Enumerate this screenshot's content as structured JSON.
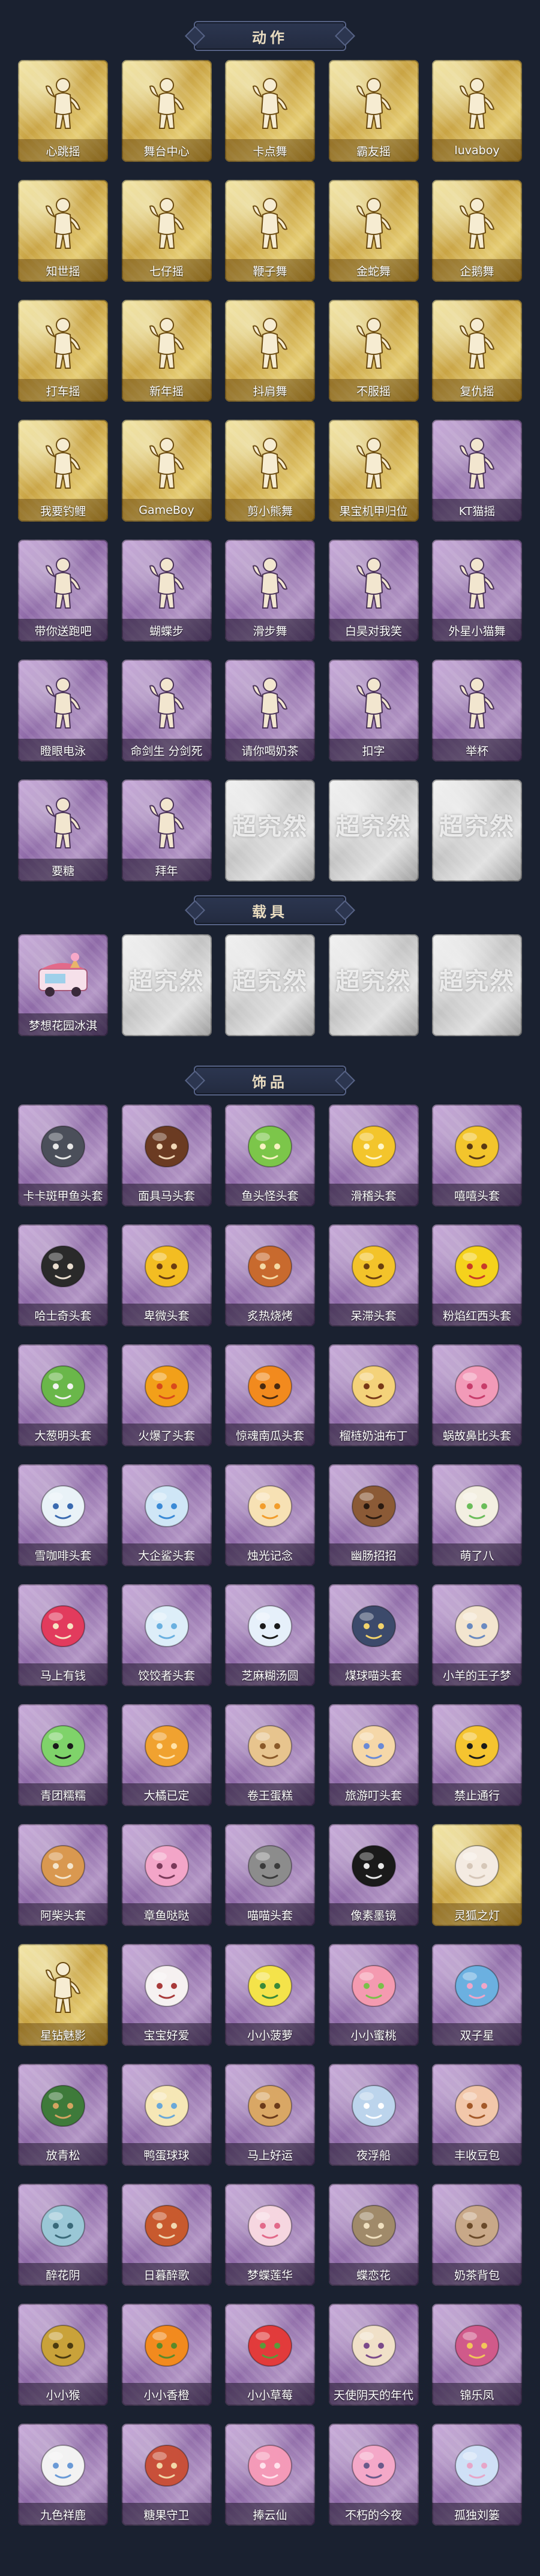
{
  "sections": [
    {
      "title": "动作",
      "items": [
        {
          "label": "心跳摇",
          "style": "gold",
          "icon": "pose-figure-icon"
        },
        {
          "label": "舞台中心",
          "style": "gold",
          "icon": "pose-figure-icon"
        },
        {
          "label": "卡点舞",
          "style": "gold",
          "icon": "pose-figure-icon"
        },
        {
          "label": "霸友摇",
          "style": "gold",
          "icon": "pose-figure-icon"
        },
        {
          "label": "luvaboy",
          "style": "gold",
          "icon": "pose-figure-icon"
        },
        {
          "label": "知世摇",
          "style": "gold",
          "icon": "pose-figure-icon"
        },
        {
          "label": "七仔摇",
          "style": "gold",
          "icon": "pose-figure-icon"
        },
        {
          "label": "鞭子舞",
          "style": "gold",
          "icon": "pose-figure-icon"
        },
        {
          "label": "金蛇舞",
          "style": "gold",
          "icon": "pose-figure-icon"
        },
        {
          "label": "企鹅舞",
          "style": "gold",
          "icon": "pose-figure-icon"
        },
        {
          "label": "打车摇",
          "style": "gold",
          "icon": "pose-figure-icon"
        },
        {
          "label": "新年摇",
          "style": "gold",
          "icon": "pose-figure-icon"
        },
        {
          "label": "抖肩舞",
          "style": "gold",
          "icon": "pose-figure-icon"
        },
        {
          "label": "不服摇",
          "style": "gold",
          "icon": "pose-figure-icon"
        },
        {
          "label": "复仇摇",
          "style": "gold",
          "icon": "pose-figure-icon"
        },
        {
          "label": "我要钓鲤",
          "style": "gold",
          "icon": "pose-figure-icon"
        },
        {
          "label": "GameBoy",
          "style": "gold",
          "icon": "pose-figure-icon"
        },
        {
          "label": "剪小熊舞",
          "style": "gold",
          "icon": "pose-figure-icon"
        },
        {
          "label": "果宝机甲归位",
          "style": "gold",
          "icon": "pose-figure-icon"
        },
        {
          "label": "KT猫摇",
          "style": "purple",
          "icon": "pose-figure-icon"
        },
        {
          "label": "带你送跑吧",
          "style": "purple",
          "icon": "pose-figure-icon"
        },
        {
          "label": "蝴蝶步",
          "style": "purple",
          "icon": "pose-figure-icon"
        },
        {
          "label": "滑步舞",
          "style": "purple",
          "icon": "pose-figure-icon"
        },
        {
          "label": "白昊对我笑",
          "style": "purple",
          "icon": "pose-figure-icon"
        },
        {
          "label": "外星小猫舞",
          "style": "purple",
          "icon": "pose-figure-icon"
        },
        {
          "label": "瞪眼电泳",
          "style": "purple",
          "icon": "pose-figure-icon"
        },
        {
          "label": "命剑生 分剑死",
          "style": "purple",
          "icon": "pose-figure-icon"
        },
        {
          "label": "请你喝奶茶",
          "style": "purple",
          "icon": "pose-figure-icon"
        },
        {
          "label": "扣字",
          "style": "purple",
          "icon": "pose-figure-icon"
        },
        {
          "label": "举杯",
          "style": "purple",
          "icon": "pose-figure-icon"
        },
        {
          "label": "要糖",
          "style": "purple",
          "icon": "pose-figure-icon"
        },
        {
          "label": "拜年",
          "style": "purple",
          "icon": "pose-figure-icon"
        },
        {
          "label": "超究然",
          "style": "silver",
          "icon": "locked"
        },
        {
          "label": "超究然",
          "style": "silver",
          "icon": "locked"
        },
        {
          "label": "超究然",
          "style": "silver",
          "icon": "locked"
        }
      ]
    },
    {
      "title": "载具",
      "items": [
        {
          "label": "梦想花园冰淇",
          "style": "purple",
          "icon": "ice-cream-truck-icon"
        },
        {
          "label": "超究然",
          "style": "silver",
          "icon": "locked"
        },
        {
          "label": "超究然",
          "style": "silver",
          "icon": "locked"
        },
        {
          "label": "超究然",
          "style": "silver",
          "icon": "locked"
        },
        {
          "label": "超究然",
          "style": "silver",
          "icon": "locked"
        }
      ]
    },
    {
      "title": "饰品",
      "items": [
        {
          "label": "卡卡斑甲鱼头套",
          "style": "purple",
          "icon": "mask-icon"
        },
        {
          "label": "面具马头套",
          "style": "purple",
          "icon": "mask-icon"
        },
        {
          "label": "鱼头怪头套",
          "style": "purple",
          "icon": "mask-icon"
        },
        {
          "label": "滑稽头套",
          "style": "purple",
          "icon": "mask-icon"
        },
        {
          "label": "嘻嘻头套",
          "style": "purple",
          "icon": "mask-icon"
        },
        {
          "label": "哈士奇头套",
          "style": "purple",
          "icon": "mask-icon"
        },
        {
          "label": "卑微头套",
          "style": "purple",
          "icon": "mask-icon"
        },
        {
          "label": "炙热烧烤",
          "style": "purple",
          "icon": "mask-icon"
        },
        {
          "label": "呆滞头套",
          "style": "purple",
          "icon": "mask-icon"
        },
        {
          "label": "粉焰红西头套",
          "style": "purple",
          "icon": "mask-icon"
        },
        {
          "label": "大葱明头套",
          "style": "purple",
          "icon": "mask-icon"
        },
        {
          "label": "火爆了头套",
          "style": "purple",
          "icon": "mask-icon"
        },
        {
          "label": "惊魂南瓜头套",
          "style": "purple",
          "icon": "mask-icon"
        },
        {
          "label": "榴梿奶油布丁",
          "style": "purple",
          "icon": "mask-icon"
        },
        {
          "label": "蜗故鼻比头套",
          "style": "purple",
          "icon": "mask-icon"
        },
        {
          "label": "雪咖啡头套",
          "style": "purple",
          "icon": "mask-icon"
        },
        {
          "label": "大企鲨头套",
          "style": "purple",
          "icon": "mask-icon"
        },
        {
          "label": "烛光记念",
          "style": "purple",
          "icon": "mask-icon"
        },
        {
          "label": "幽肠招招",
          "style": "purple",
          "icon": "mask-icon"
        },
        {
          "label": "萌了八",
          "style": "purple",
          "icon": "mask-icon"
        },
        {
          "label": "马上有钱",
          "style": "purple",
          "icon": "mask-icon"
        },
        {
          "label": "饺饺者头套",
          "style": "purple",
          "icon": "mask-icon"
        },
        {
          "label": "芝麻糊汤圆",
          "style": "purple",
          "icon": "mask-icon"
        },
        {
          "label": "煤球喵头套",
          "style": "purple",
          "icon": "mask-icon"
        },
        {
          "label": "小羊的王子梦",
          "style": "purple",
          "icon": "mask-icon"
        },
        {
          "label": "青团糯糯",
          "style": "purple",
          "icon": "mask-icon"
        },
        {
          "label": "大橘已定",
          "style": "purple",
          "icon": "mask-icon"
        },
        {
          "label": "卷王蛋糕",
          "style": "purple",
          "icon": "mask-icon"
        },
        {
          "label": "旅游叮头套",
          "style": "purple",
          "icon": "mask-icon"
        },
        {
          "label": "禁止通行",
          "style": "purple",
          "icon": "mask-icon"
        },
        {
          "label": "阿柴头套",
          "style": "purple",
          "icon": "mask-icon"
        },
        {
          "label": "章鱼哒哒",
          "style": "purple",
          "icon": "mask-icon"
        },
        {
          "label": "喵喵头套",
          "style": "purple",
          "icon": "mask-icon"
        },
        {
          "label": "像素墨镜",
          "style": "purple",
          "icon": "mask-icon"
        },
        {
          "label": "灵狐之灯",
          "style": "gold",
          "icon": "mask-icon"
        },
        {
          "label": "星钻魅影",
          "style": "gold",
          "icon": "pose-figure-icon"
        },
        {
          "label": "宝宝好爱",
          "style": "purple",
          "icon": "mask-icon"
        },
        {
          "label": "小小菠萝",
          "style": "purple",
          "icon": "mask-icon"
        },
        {
          "label": "小小蜜桃",
          "style": "purple",
          "icon": "mask-icon"
        },
        {
          "label": "双子星",
          "style": "purple",
          "icon": "mask-icon"
        },
        {
          "label": "放青松",
          "style": "purple",
          "icon": "mask-icon"
        },
        {
          "label": "鸭蛋球球",
          "style": "purple",
          "icon": "mask-icon"
        },
        {
          "label": "马上好运",
          "style": "purple",
          "icon": "mask-icon"
        },
        {
          "label": "夜浮船",
          "style": "purple",
          "icon": "mask-icon"
        },
        {
          "label": "丰收豆包",
          "style": "purple",
          "icon": "mask-icon"
        },
        {
          "label": "醉花阴",
          "style": "purple",
          "icon": "mask-icon"
        },
        {
          "label": "日暮醉歌",
          "style": "purple",
          "icon": "mask-icon"
        },
        {
          "label": "梦蝶莲华",
          "style": "purple",
          "icon": "mask-icon"
        },
        {
          "label": "蝶恋花",
          "style": "purple",
          "icon": "mask-icon"
        },
        {
          "label": "奶茶背包",
          "style": "purple",
          "icon": "mask-icon"
        },
        {
          "label": "小小猴",
          "style": "purple",
          "icon": "mask-icon"
        },
        {
          "label": "小小香橙",
          "style": "purple",
          "icon": "mask-icon"
        },
        {
          "label": "小小草莓",
          "style": "purple",
          "icon": "mask-icon"
        },
        {
          "label": "天使阴天的年代",
          "style": "purple",
          "icon": "mask-icon"
        },
        {
          "label": "锦乐凤",
          "style": "purple",
          "icon": "mask-icon"
        },
        {
          "label": "九色祥鹿",
          "style": "purple",
          "icon": "mask-icon"
        },
        {
          "label": "糖果守卫",
          "style": "purple",
          "icon": "mask-icon"
        },
        {
          "label": "捧云仙",
          "style": "purple",
          "icon": "mask-icon"
        },
        {
          "label": "不朽的今夜",
          "style": "purple",
          "icon": "mask-icon"
        },
        {
          "label": "孤独刘篓",
          "style": "purple",
          "icon": "mask-icon"
        }
      ]
    }
  ],
  "icons": {
    "locked_text": "超究然"
  },
  "colors": {
    "background": "#1a2130",
    "banner_text": "#e9dcc0",
    "gold": "#c9a444",
    "purple": "#8e6aa7",
    "silver": "#c3c3c3"
  }
}
